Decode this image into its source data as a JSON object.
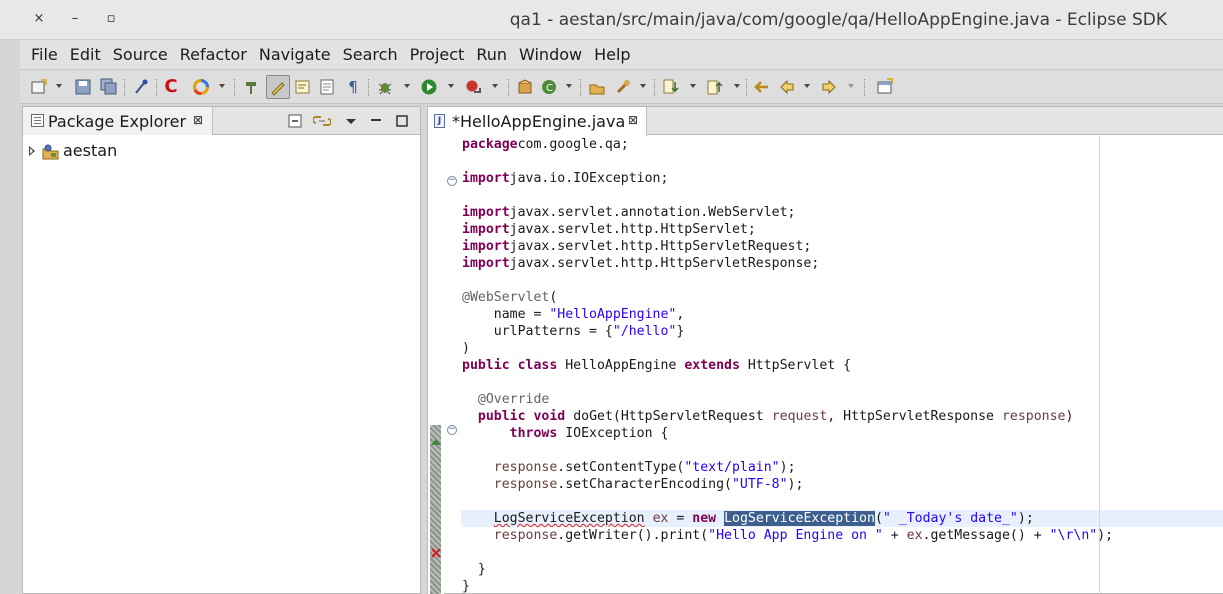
{
  "window": {
    "title": "qa1 - aestan/src/main/java/com/google/qa/HelloAppEngine.java - Eclipse SDK",
    "controls": {
      "close": "×",
      "minimize": "–",
      "maximize": "▫"
    }
  },
  "menubar": {
    "items": [
      "File",
      "Edit",
      "Source",
      "Refactor",
      "Navigate",
      "Search",
      "Project",
      "Run",
      "Window",
      "Help"
    ]
  },
  "toolbar": {
    "icons": [
      "new-icon",
      "save-icon",
      "save-all-icon",
      "pin-icon",
      "code-recommenders-icon",
      "google-cloud-icon",
      "open-type-icon",
      "toggle-highlight-icon",
      "mark-occurrences-icon",
      "show-whitespace-icon",
      "bookmark-icon",
      "debug-icon",
      "run-icon",
      "external-tools-icon",
      "new-java-package-icon",
      "refresh-icon",
      "open-task-icon",
      "search-icon",
      "next-annotation-icon",
      "previous-annotation-icon",
      "last-edit-icon",
      "back-icon",
      "forward-icon",
      "open-perspective-icon"
    ]
  },
  "package_explorer": {
    "title": "Package Explorer",
    "close": "⊠",
    "tree": [
      {
        "label": "aestan",
        "icon": "java-project-icon",
        "expanded": false
      }
    ]
  },
  "editor": {
    "tab_title": "*HelloAppEngine.java",
    "close": "⊠",
    "current_line": 23,
    "code_lines": [
      [
        [
          "kw",
          "package"
        ],
        [
          "",
          "com.google.qa;"
        ]
      ],
      [],
      [
        [
          "kw",
          "import"
        ],
        [
          "",
          "java.io.IOException;"
        ]
      ],
      [],
      [
        [
          "kw",
          "import"
        ],
        [
          "",
          "javax.servlet.annotation.WebServlet;"
        ]
      ],
      [
        [
          "kw",
          "import"
        ],
        [
          "",
          "javax.servlet.http.HttpServlet;"
        ]
      ],
      [
        [
          "kw",
          "import"
        ],
        [
          "",
          "javax.servlet.http.HttpServletRequest;"
        ]
      ],
      [
        [
          "kw",
          "import"
        ],
        [
          "",
          "javax.servlet.http.HttpServletResponse;"
        ]
      ],
      [],
      [
        [
          "ann",
          "@WebServlet"
        ],
        [
          "",
          "("
        ]
      ],
      [
        [
          "",
          "    name = "
        ],
        [
          "str",
          "\"HelloAppEngine\""
        ],
        [
          "",
          ","
        ]
      ],
      [
        [
          "",
          "    urlPatterns = {"
        ],
        [
          "str",
          "\"/hello\""
        ],
        [
          "",
          "}"
        ]
      ],
      [
        [
          "",
          ")"
        ]
      ],
      [
        [
          "kw",
          "public"
        ],
        [
          "",
          " "
        ],
        [
          "kw",
          "class"
        ],
        [
          "",
          " HelloAppEngine "
        ],
        [
          "kw",
          "extends"
        ],
        [
          "",
          " HttpServlet {"
        ]
      ],
      [],
      [
        [
          "",
          "  "
        ],
        [
          "ann",
          "@Override"
        ]
      ],
      [
        [
          "",
          "  "
        ],
        [
          "kw",
          "public"
        ],
        [
          "",
          " "
        ],
        [
          "kw",
          "void"
        ],
        [
          "",
          " doGet(HttpServletRequest "
        ],
        [
          "param",
          "request"
        ],
        [
          "",
          ", HttpServletResponse "
        ],
        [
          "param",
          "response"
        ],
        [
          "",
          ")"
        ]
      ],
      [
        [
          "",
          "      "
        ],
        [
          "kw",
          "throws"
        ],
        [
          "",
          " IOException {"
        ]
      ],
      [],
      [
        [
          "",
          "    "
        ],
        [
          "param",
          "response"
        ],
        [
          "",
          ".setContentType("
        ],
        [
          "str",
          "\"text/plain\""
        ],
        [
          "",
          ");"
        ]
      ],
      [
        [
          "",
          "    "
        ],
        [
          "param",
          "response"
        ],
        [
          "",
          ".setCharacterEncoding("
        ],
        [
          "str",
          "\"UTF-8\""
        ],
        [
          "",
          ");"
        ]
      ],
      [],
      [
        [
          "",
          "    "
        ],
        [
          "err",
          "LogServiceException"
        ],
        [
          "",
          " "
        ],
        [
          "param",
          "ex"
        ],
        [
          "",
          " = "
        ],
        [
          "kw",
          "new"
        ],
        [
          "",
          " "
        ],
        [
          "sel",
          "LogServiceException"
        ],
        [
          "",
          "("
        ],
        [
          "str",
          "\" _Today's date_\""
        ],
        [
          "",
          ");"
        ]
      ],
      [
        [
          "",
          "    "
        ],
        [
          "param",
          "response"
        ],
        [
          "",
          ".getWriter().print("
        ],
        [
          "str",
          "\"Hello App Engine on \""
        ],
        [
          "",
          " + "
        ],
        [
          "param",
          "ex"
        ],
        [
          "",
          ".getMessage() + "
        ],
        [
          "str",
          "\"\\r\\n\""
        ],
        [
          "",
          ");"
        ]
      ],
      [],
      [
        [
          "",
          "  }"
        ]
      ],
      [
        [
          "",
          "}"
        ]
      ]
    ]
  },
  "colors": {
    "keyword": "#7f0055",
    "string": "#2a00ff",
    "annotation": "#646464",
    "selection": "#3d5f8e",
    "error_underline": "#e02020"
  }
}
